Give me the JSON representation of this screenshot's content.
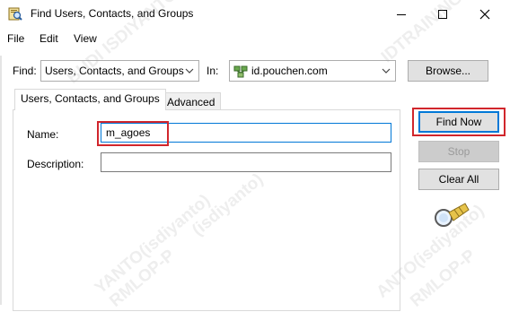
{
  "window": {
    "title": "Find Users, Contacts, and Groups",
    "icon": "find-magnifier-icon"
  },
  "menu": [
    "File",
    "Edit",
    "View"
  ],
  "find_row": {
    "find_label": "Find:",
    "find_value": "Users, Contacts, and Groups",
    "in_label": "In:",
    "in_value": "id.pouchen.com",
    "in_icon": "directory-domain-icon",
    "browse_label": "Browse..."
  },
  "tabs": [
    "Users, Contacts, and Groups",
    "Advanced"
  ],
  "form": {
    "name_label": "Name:",
    "name_value": "m_agoes",
    "description_label": "Description:",
    "description_value": ""
  },
  "buttons": {
    "find_now": "Find Now",
    "stop": "Stop",
    "clear_all": "Clear All"
  },
  "search_graphic_icon": "flashlight-search-icon",
  "watermarks": [
    "BUDI ISDIYANTO",
    "IDTRAINING",
    "YANTO(isdiyanto)",
    "RMLOP-P",
    "(isdiyanto)",
    "ANTO(isdiyanto)",
    "RMLOP-P"
  ],
  "colors": {
    "highlight": "#d1262c",
    "focus": "#0078d7"
  }
}
